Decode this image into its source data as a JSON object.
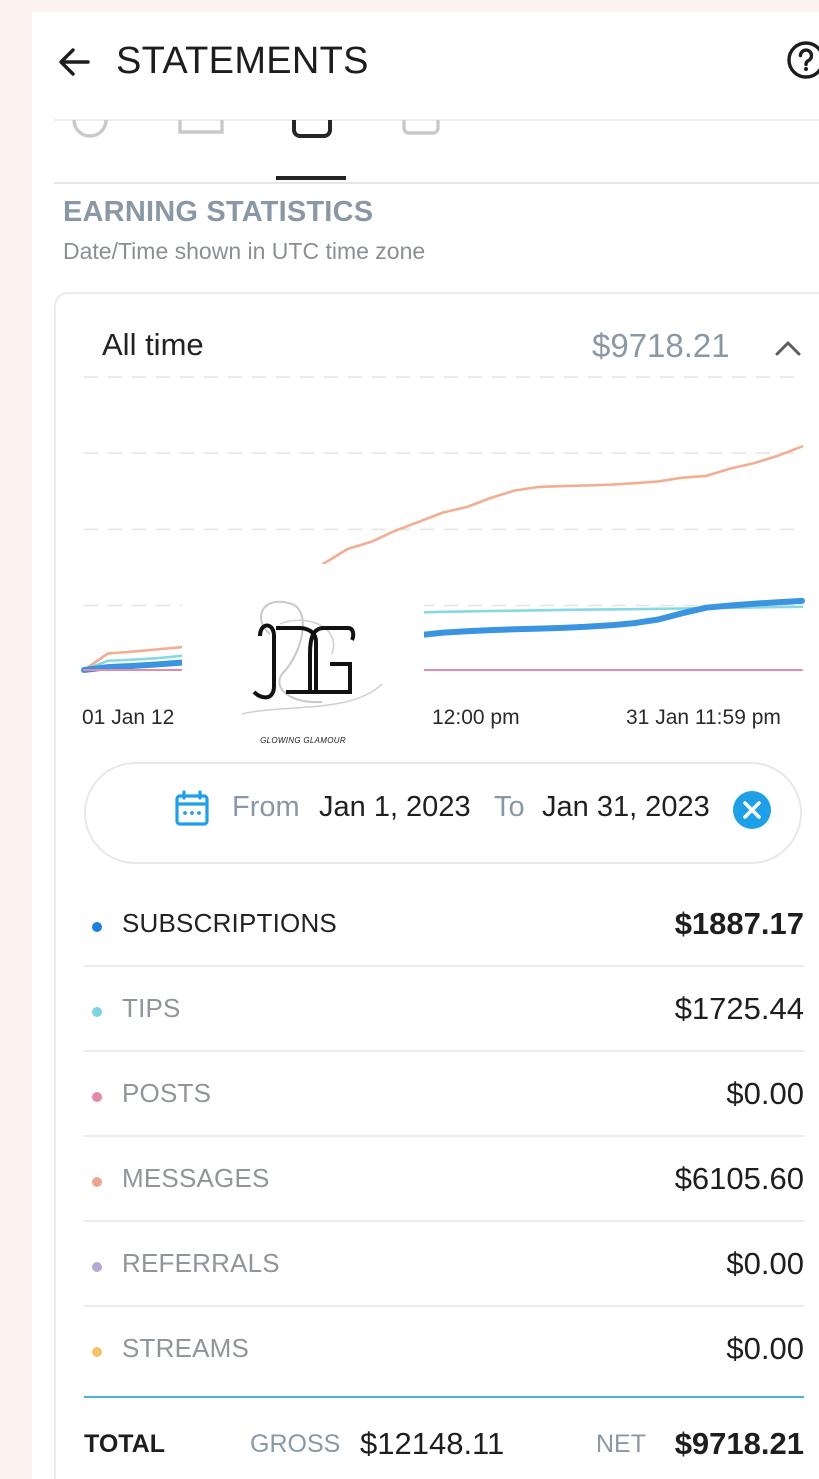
{
  "header": {
    "title": "STATEMENTS",
    "back_icon": "arrow-left-icon",
    "help_icon": "help-circle-icon"
  },
  "section": {
    "title": "EARNING STATISTICS",
    "subtitle": "Date/Time shown in UTC time zone"
  },
  "card": {
    "period_label": "All time",
    "period_total": "$9718.21"
  },
  "watermark": {
    "caption": "GLOWING GLAMOUR"
  },
  "chart_data": {
    "type": "line",
    "title": "",
    "xlabel": "",
    "ylabel": "",
    "x_tick_labels": [
      "01 Jan 12",
      "12:00 pm",
      "31 Jan 11:59 pm"
    ],
    "grid": true,
    "legend": "none",
    "ylim": [
      0,
      8000
    ],
    "x": [
      1,
      2,
      3,
      4,
      5,
      6,
      7,
      8,
      9,
      10,
      11,
      12,
      13,
      14,
      15,
      16,
      17,
      18,
      19,
      20,
      21,
      22,
      23,
      24,
      25,
      26,
      27,
      28,
      29,
      30,
      31
    ],
    "series": [
      {
        "name": "MESSAGES",
        "color": "#f2ad92",
        "values": [
          0,
          450,
          500,
          560,
          620,
          700,
          900,
          1300,
          1800,
          2300,
          2900,
          3300,
          3500,
          3800,
          4050,
          4300,
          4450,
          4700,
          4900,
          5000,
          5020,
          5040,
          5060,
          5100,
          5150,
          5250,
          5300,
          5500,
          5650,
          5850,
          6105.6
        ]
      },
      {
        "name": "TIPS",
        "color": "#86d8e3",
        "values": [
          0,
          250,
          280,
          320,
          380,
          450,
          600,
          800,
          1000,
          1200,
          1350,
          1450,
          1500,
          1540,
          1570,
          1590,
          1600,
          1610,
          1620,
          1630,
          1640,
          1650,
          1655,
          1660,
          1670,
          1680,
          1690,
          1700,
          1710,
          1718,
          1725.44
        ]
      },
      {
        "name": "SUBSCRIPTIONS",
        "color": "#3b94e0",
        "values": [
          0,
          80,
          110,
          150,
          200,
          260,
          330,
          400,
          480,
          560,
          640,
          720,
          800,
          880,
          950,
          1020,
          1060,
          1090,
          1110,
          1130,
          1150,
          1180,
          1220,
          1280,
          1380,
          1550,
          1700,
          1760,
          1810,
          1850,
          1887.17
        ]
      },
      {
        "name": "POSTS",
        "color": "#e48aa7",
        "values": [
          0,
          0,
          0,
          0,
          0,
          0,
          0,
          0,
          0,
          0,
          0,
          0,
          0,
          0,
          0,
          0,
          0,
          0,
          0,
          0,
          0,
          0,
          0,
          0,
          0,
          0,
          0,
          0,
          0,
          0,
          0
        ]
      }
    ]
  },
  "date_range": {
    "from_word": "From",
    "from_value": "Jan 1, 2023",
    "to_word": "To",
    "to_value": "Jan 31, 2023",
    "calendar_icon": "calendar-icon",
    "clear_icon": "clear-circle-icon"
  },
  "breakdown": [
    {
      "label": "SUBSCRIPTIONS",
      "amount": "$1887.17",
      "dot_color": "#1f7fd6",
      "emphasis": true
    },
    {
      "label": "TIPS",
      "amount": "$1725.44",
      "dot_color": "#7fd3e0",
      "emphasis": false
    },
    {
      "label": "POSTS",
      "amount": "$0.00",
      "dot_color": "#e48aa7",
      "emphasis": false
    },
    {
      "label": "MESSAGES",
      "amount": "$6105.60",
      "dot_color": "#f0a58f",
      "emphasis": false
    },
    {
      "label": "REFERRALS",
      "amount": "$0.00",
      "dot_color": "#b6a7d6",
      "emphasis": false
    },
    {
      "label": "STREAMS",
      "amount": "$0.00",
      "dot_color": "#f4c26b",
      "emphasis": false
    }
  ],
  "total": {
    "label": "TOTAL",
    "gross_word": "GROSS",
    "gross_value": "$12148.11",
    "net_word": "NET",
    "net_value": "$9718.21"
  },
  "colors": {
    "accent": "#1f9fe8",
    "muted": "#8a98a6",
    "total_divider": "#4db6cf"
  }
}
